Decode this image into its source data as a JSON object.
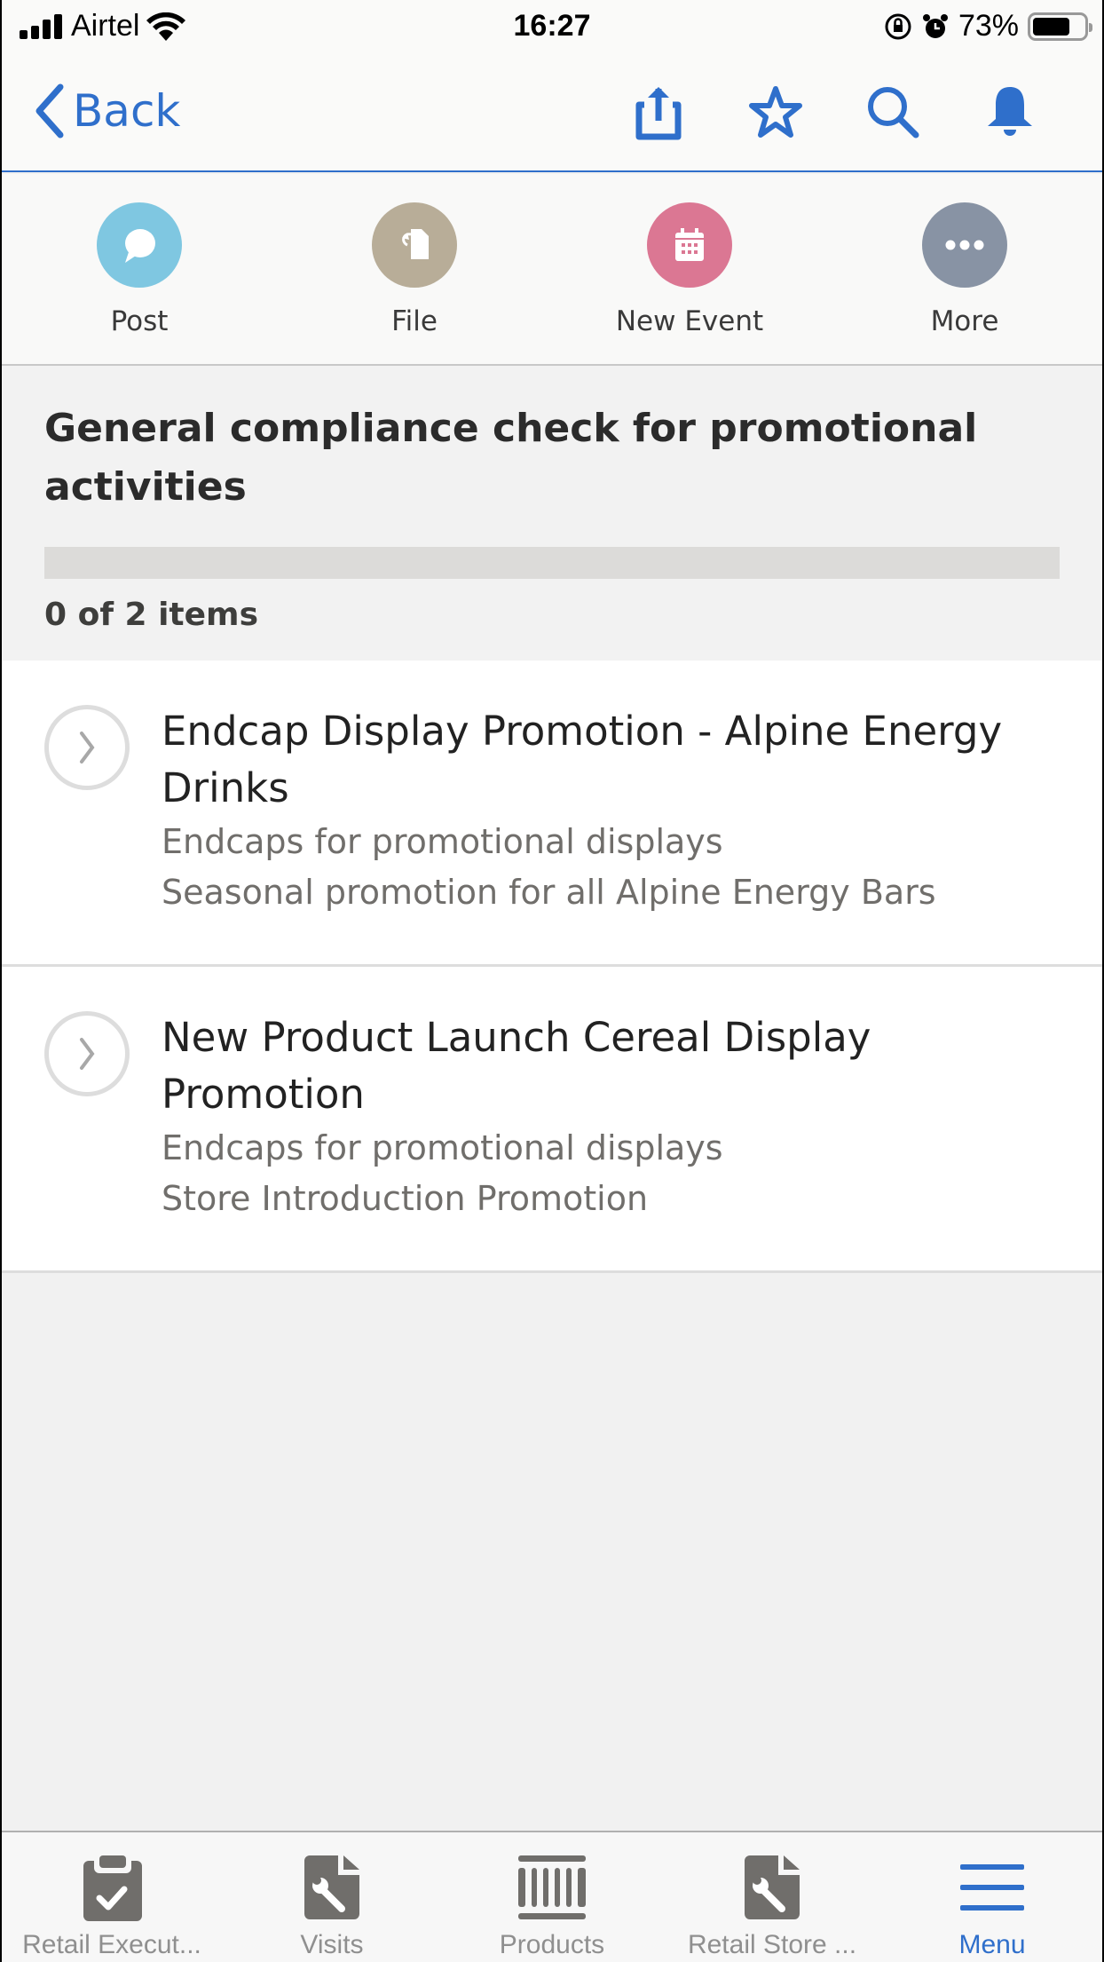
{
  "status_bar": {
    "carrier": "Airtel",
    "time": "16:27",
    "battery_percent": "73%",
    "battery_level": 0.73
  },
  "nav": {
    "back_label": "Back",
    "icons": [
      "share-icon",
      "star-icon",
      "search-icon",
      "bell-icon"
    ]
  },
  "actions": [
    {
      "label": "Post",
      "icon": "chat-bubble-icon",
      "color": "#7fc7e1"
    },
    {
      "label": "File",
      "icon": "file-icon",
      "color": "#b8ad98"
    },
    {
      "label": "New Event",
      "icon": "calendar-icon",
      "color": "#db7793"
    },
    {
      "label": "More",
      "icon": "more-icon",
      "color": "#8893a4"
    }
  ],
  "checklist": {
    "title": "General compliance check for promotional activities",
    "progress_fraction": 0,
    "count_text": "0 of 2 items"
  },
  "items": [
    {
      "title": "Endcap Display Promotion - Alpine Energy Drinks",
      "line1": "Endcaps for promotional displays",
      "line2": "Seasonal promotion for all Alpine Energy Bars"
    },
    {
      "title": "New Product Launch Cereal Display Promotion",
      "line1": "Endcaps for promotional displays",
      "line2": "Store Introduction Promotion"
    }
  ],
  "tabs": [
    {
      "label": "Retail Execut...",
      "icon": "clipboard-check-icon",
      "active": false
    },
    {
      "label": "Visits",
      "icon": "wrench-doc-icon",
      "active": false
    },
    {
      "label": "Products",
      "icon": "barcode-icon",
      "active": false
    },
    {
      "label": "Retail Store ...",
      "icon": "wrench-doc-icon",
      "active": false
    },
    {
      "label": "Menu",
      "icon": "menu-icon",
      "active": true
    }
  ],
  "colors": {
    "accent": "#2f6fcb",
    "tab_inactive": "#8f8f8f",
    "icon_gray": "#706e6b"
  }
}
